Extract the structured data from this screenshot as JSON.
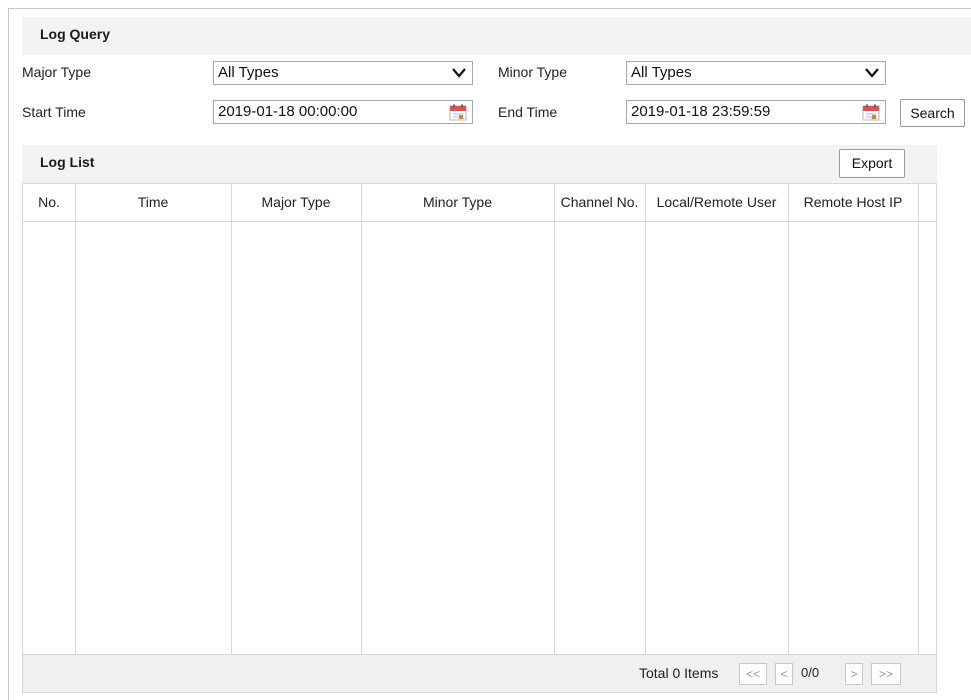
{
  "log_query": {
    "title": "Log Query",
    "major_type": {
      "label": "Major Type",
      "value": "All Types"
    },
    "minor_type": {
      "label": "Minor Type",
      "value": "All Types"
    },
    "start_time": {
      "label": "Start Time",
      "value": "2019-01-18 00:00:00"
    },
    "end_time": {
      "label": "End Time",
      "value": "2019-01-18 23:59:59"
    },
    "search_label": "Search"
  },
  "log_list": {
    "title": "Log List",
    "export_label": "Export",
    "columns": [
      "No.",
      "Time",
      "Major Type",
      "Minor Type",
      "Channel No.",
      "Local/Remote User",
      "Remote Host IP"
    ],
    "rows": [],
    "footer": {
      "total_text": "Total 0 Items",
      "first": "<<",
      "prev": "<",
      "page": "0/0",
      "next": ">",
      "last": ">>"
    }
  },
  "icons": {
    "dropdown": "chevron-down-icon",
    "calendar": "calendar-icon"
  },
  "colors": {
    "section_bg": "#f3f3f3",
    "border": "#a8a8a8",
    "calendar_red": "#d9534f"
  }
}
